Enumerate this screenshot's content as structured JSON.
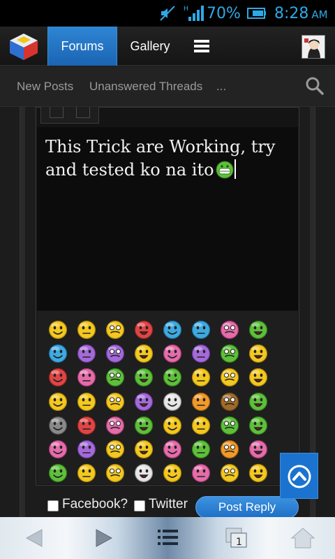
{
  "status_bar": {
    "signal_type": "H",
    "battery_percent": "70%",
    "time": "8:28",
    "ampm": "AM",
    "accent_color": "#2ea8e5"
  },
  "nav": {
    "tabs": [
      "Forums",
      "Gallery"
    ],
    "active_tab": "Forums",
    "menu_icon": "hamburger-icon"
  },
  "subnav": {
    "links": [
      "New Posts",
      "Unanswered Threads",
      "..."
    ],
    "search_icon": "search-icon"
  },
  "editor": {
    "text_line1": "This Trick are Working, try",
    "text_line2": "and tested ko na ito"
  },
  "reply_options": {
    "facebook_label": "Facebook?",
    "twitter_label": "Twitter",
    "post_button": "Post Reply"
  },
  "colors": {
    "accent_blue": "#1f6fc6",
    "emoji_yellow": "#f3c81f",
    "emoji_green": "#5fbf3a",
    "emoji_blue": "#3fa9e0",
    "emoji_pink": "#e36da8",
    "emoji_purple": "#a36ad8",
    "emoji_red": "#e04545"
  },
  "emoji_grid": [
    [
      "yellow",
      "yellow",
      "yellow",
      "red",
      "blue",
      "blue",
      "pink",
      "green"
    ],
    [
      "blue",
      "purple",
      "purple",
      "yellow",
      "pink",
      "purple",
      "green",
      "yellow"
    ],
    [
      "red",
      "pink",
      "green",
      "green",
      "green",
      "yellow",
      "yellow",
      "yellow"
    ],
    [
      "yellow",
      "yellow",
      "yellow",
      "purple",
      "white",
      "orange",
      "brown",
      "green"
    ],
    [
      "gray",
      "red",
      "pink",
      "green",
      "yellow",
      "yellow",
      "green",
      "green"
    ],
    [
      "pink",
      "purple",
      "yellow",
      "yellow",
      "pink",
      "green",
      "orange",
      "pink"
    ],
    [
      "green",
      "yellow",
      "yellow",
      "white",
      "yellow",
      "pink",
      "yellow",
      "yellow"
    ]
  ]
}
